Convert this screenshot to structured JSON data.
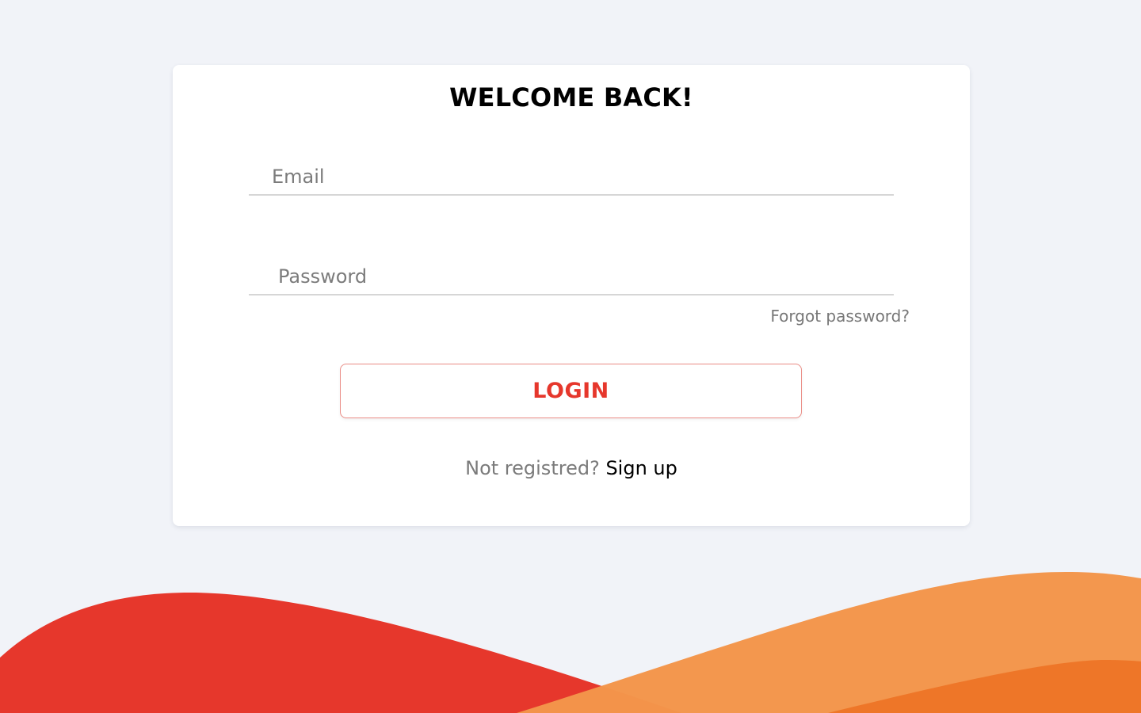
{
  "login": {
    "title": "WELCOME BACK!",
    "email_placeholder": "Email",
    "email_value": "",
    "password_placeholder": "Password",
    "password_value": "",
    "forgot_label": "Forgot password?",
    "login_label": "LOGIN",
    "signup_prompt": "Not registred?",
    "signup_label": "Sign up"
  },
  "colors": {
    "background": "#f1f3f8",
    "accent_red": "#e6372c",
    "wave_orange": "#f3954a",
    "wave_dark_orange": "#ee7628"
  }
}
